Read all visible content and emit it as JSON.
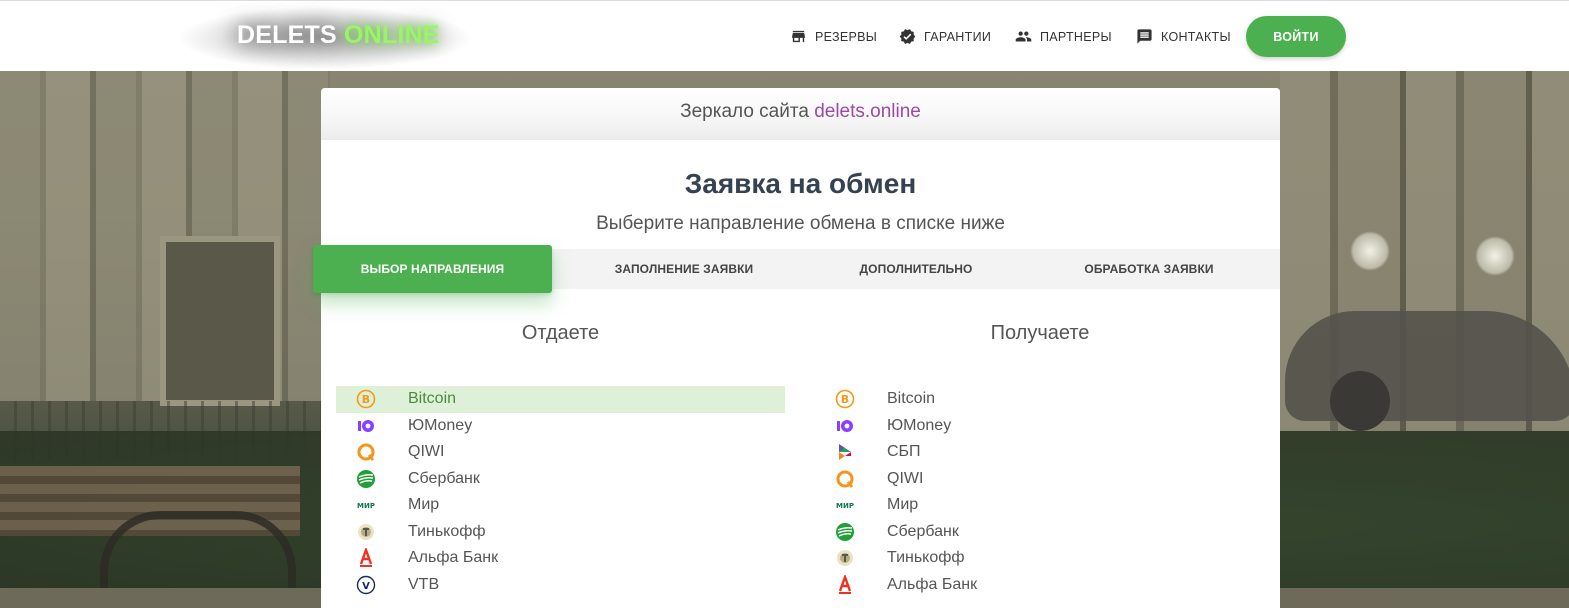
{
  "header": {
    "logo_part1": "DELETS",
    "logo_part2": "ONLINE",
    "nav": [
      {
        "label": "РЕЗЕРВЫ",
        "icon": "store-icon"
      },
      {
        "label": "ГАРАНТИИ",
        "icon": "verified-badge-icon"
      },
      {
        "label": "ПАРТНЕРЫ",
        "icon": "people-icon"
      },
      {
        "label": "КОНТАКТЫ",
        "icon": "message-icon"
      }
    ],
    "login_label": "ВОЙТИ"
  },
  "mirror": {
    "text": "Зеркало сайта",
    "link": "delets.online"
  },
  "title": "Заявка на обмен",
  "subtitle": "Выберите направление обмена в списке ниже",
  "steps": [
    {
      "label": "ВЫБОР НАПРАВЛЕНИЯ",
      "active": true
    },
    {
      "label": "ЗАПОЛНЕНИЕ ЗАЯВКИ",
      "active": false
    },
    {
      "label": "ДОПОЛНИТЕЛЬНО",
      "active": false
    },
    {
      "label": "ОБРАБОТКА ЗАЯВКИ",
      "active": false
    }
  ],
  "give": {
    "title": "Отдаете",
    "items": [
      {
        "label": "Bitcoin",
        "icon": "bitcoin-icon",
        "selected": true
      },
      {
        "label": "ЮMoney",
        "icon": "yoomoney-icon"
      },
      {
        "label": "QIWI",
        "icon": "qiwi-icon"
      },
      {
        "label": "Сбербанк",
        "icon": "sberbank-icon"
      },
      {
        "label": "Мир",
        "icon": "mir-icon"
      },
      {
        "label": "Тинькофф",
        "icon": "tinkoff-icon"
      },
      {
        "label": "Альфа Банк",
        "icon": "alfabank-icon"
      },
      {
        "label": "VTB",
        "icon": "vtb-icon"
      }
    ]
  },
  "receive": {
    "title": "Получаете",
    "items": [
      {
        "label": "Bitcoin",
        "icon": "bitcoin-icon"
      },
      {
        "label": "ЮMoney",
        "icon": "yoomoney-icon"
      },
      {
        "label": "СБП",
        "icon": "sbp-icon"
      },
      {
        "label": "QIWI",
        "icon": "qiwi-icon"
      },
      {
        "label": "Мир",
        "icon": "mir-icon"
      },
      {
        "label": "Сбербанк",
        "icon": "sberbank-icon"
      },
      {
        "label": "Тинькофф",
        "icon": "tinkoff-icon"
      },
      {
        "label": "Альфа Банк",
        "icon": "alfabank-icon"
      }
    ]
  },
  "colors": {
    "accent_green": "#4caf50",
    "selected_row": "#dff0d8",
    "link_purple": "#9c4aa6",
    "logo_green": "#9cf26a"
  }
}
